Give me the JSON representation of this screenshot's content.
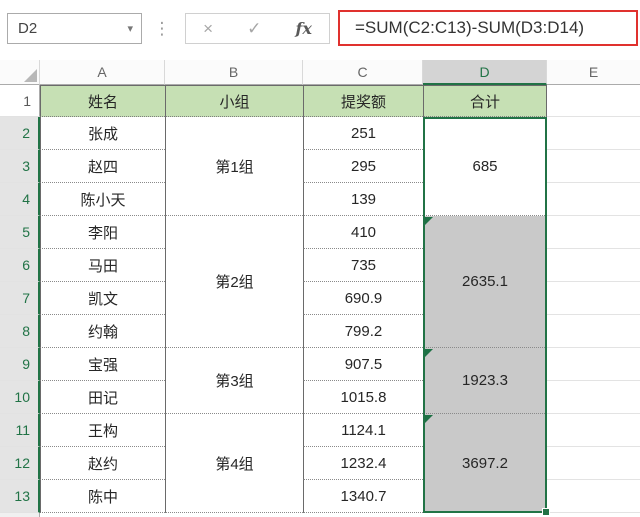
{
  "toolbar": {
    "name_box": "D2",
    "cancel_label": "×",
    "enter_label": "✓",
    "fx_label": "fx",
    "formula": "=SUM(C2:C13)-SUM(D3:D14)"
  },
  "sheet": {
    "column_letters": [
      "A",
      "B",
      "C",
      "D",
      "E"
    ],
    "selected_column": "D",
    "row_numbers": [
      "1",
      "2",
      "3",
      "4",
      "5",
      "6",
      "7",
      "8",
      "9",
      "10",
      "11",
      "12",
      "13"
    ],
    "header_row": {
      "name": "姓名",
      "group": "小组",
      "amount": "提奖额",
      "total": "合计"
    },
    "names": [
      "张成",
      "赵四",
      "陈小天",
      "李阳",
      "马田",
      "凯文",
      "约翰",
      "宝强",
      "田记",
      "王构",
      "赵约",
      "陈中"
    ],
    "amounts": [
      "251",
      "295",
      "139",
      "410",
      "735",
      "690.9",
      "799.2",
      "907.5",
      "1015.8",
      "1124.1",
      "1232.4",
      "1340.7"
    ],
    "groups": [
      {
        "label": "第1组",
        "total": "685",
        "rows": 3
      },
      {
        "label": "第2组",
        "total": "2635.1",
        "rows": 4
      },
      {
        "label": "第3组",
        "total": "1923.3",
        "rows": 2
      },
      {
        "label": "第4组",
        "total": "3697.2",
        "rows": 3
      }
    ],
    "selected_range": "D2:D13"
  },
  "colors": {
    "accent_green": "#217346",
    "header_fill": "#c6e0b4",
    "selection_fill": "#c9c9c9",
    "annotation_red": "#e0312e"
  }
}
